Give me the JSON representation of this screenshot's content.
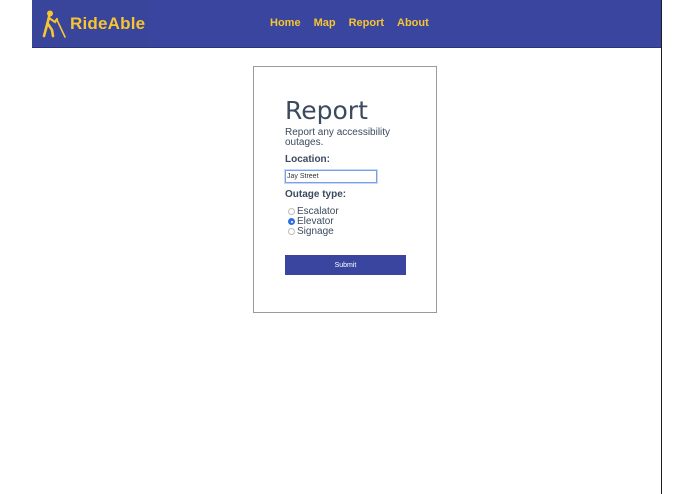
{
  "brand": {
    "name": "RideAble",
    "icon": "person-walking-cane-icon"
  },
  "nav": {
    "items": [
      {
        "label": "Home"
      },
      {
        "label": "Map"
      },
      {
        "label": "Report"
      },
      {
        "label": "About"
      }
    ]
  },
  "report": {
    "title": "Report",
    "description": "Report any accessibility outages.",
    "location_label": "Location:",
    "location_value": "Jay Street",
    "outage_type_label": "Outage type:",
    "options": [
      {
        "label": "Escalator",
        "checked": false
      },
      {
        "label": "Elevator",
        "checked": true
      },
      {
        "label": "Signage",
        "checked": false
      }
    ],
    "submit_label": "Submit"
  },
  "colors": {
    "nav_bg": "#3a45a0",
    "accent": "#f6c531",
    "text": "#3b4a5e",
    "radio_checked": "#2f6fe0"
  }
}
